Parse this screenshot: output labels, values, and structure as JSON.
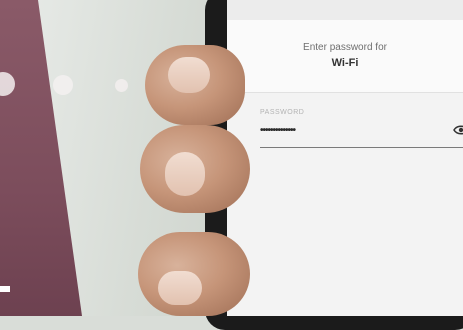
{
  "password_dialog": {
    "prompt": "Enter password for",
    "network_name": "Wi-Fi",
    "field_label": "PASSWORD",
    "field_value": "••••••••••••••",
    "icons": {
      "reveal": "eye-icon"
    }
  },
  "colors": {
    "accent_panel": "#7c4d5c",
    "screen_background": "#f3f3f3"
  }
}
